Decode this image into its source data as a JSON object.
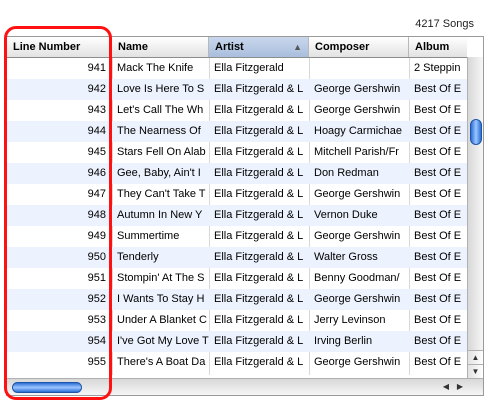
{
  "song_count": "4217 Songs",
  "columns": [
    {
      "key": "line",
      "label": "Line Number"
    },
    {
      "key": "name",
      "label": "Name"
    },
    {
      "key": "artist",
      "label": "Artist"
    },
    {
      "key": "composer",
      "label": "Composer"
    },
    {
      "key": "album",
      "label": "Album"
    }
  ],
  "sort_icon": "sort-ascending-icon",
  "highlight_color": "#ff1111",
  "rows": [
    {
      "line": "941",
      "name": "Mack The Knife",
      "artist": "Ella Fitzgerald",
      "composer": "",
      "album": "2 Steppin"
    },
    {
      "line": "942",
      "name": "Love Is Here To S",
      "artist": "Ella Fitzgerald & L",
      "composer": "George Gershwin",
      "album": "Best Of E"
    },
    {
      "line": "943",
      "name": "Let's Call The Wh",
      "artist": "Ella Fitzgerald & L",
      "composer": "George Gershwin",
      "album": "Best Of E"
    },
    {
      "line": "944",
      "name": "The Nearness Of",
      "artist": "Ella Fitzgerald & L",
      "composer": "Hoagy Carmichae",
      "album": "Best Of E"
    },
    {
      "line": "945",
      "name": "Stars Fell On Alab",
      "artist": "Ella Fitzgerald & L",
      "composer": "Mitchell Parish/Fr",
      "album": "Best Of E"
    },
    {
      "line": "946",
      "name": "Gee, Baby, Ain't I",
      "artist": "Ella Fitzgerald & L",
      "composer": "Don Redman",
      "album": "Best Of E"
    },
    {
      "line": "947",
      "name": "They Can't Take T",
      "artist": "Ella Fitzgerald & L",
      "composer": "George Gershwin",
      "album": "Best Of E"
    },
    {
      "line": "948",
      "name": "Autumn In New Y",
      "artist": "Ella Fitzgerald & L",
      "composer": "Vernon Duke",
      "album": "Best Of E"
    },
    {
      "line": "949",
      "name": "Summertime",
      "artist": "Ella Fitzgerald & L",
      "composer": "George Gershwin",
      "album": "Best Of E"
    },
    {
      "line": "950",
      "name": "Tenderly",
      "artist": "Ella Fitzgerald & L",
      "composer": "Walter Gross",
      "album": "Best Of E"
    },
    {
      "line": "951",
      "name": "Stompin' At The S",
      "artist": "Ella Fitzgerald & L",
      "composer": "Benny Goodman/",
      "album": "Best Of E"
    },
    {
      "line": "952",
      "name": "I Wants To Stay H",
      "artist": "Ella Fitzgerald & L",
      "composer": "George Gershwin",
      "album": "Best Of E"
    },
    {
      "line": "953",
      "name": "Under A Blanket C",
      "artist": "Ella Fitzgerald & L",
      "composer": "Jerry Levinson",
      "album": "Best Of E"
    },
    {
      "line": "954",
      "name": "I've Got My Love T",
      "artist": "Ella Fitzgerald & L",
      "composer": "Irving Berlin",
      "album": "Best Of E"
    },
    {
      "line": "955",
      "name": "There's A Boat Da",
      "artist": "Ella Fitzgerald & L",
      "composer": "George Gershwin",
      "album": "Best Of E"
    }
  ]
}
